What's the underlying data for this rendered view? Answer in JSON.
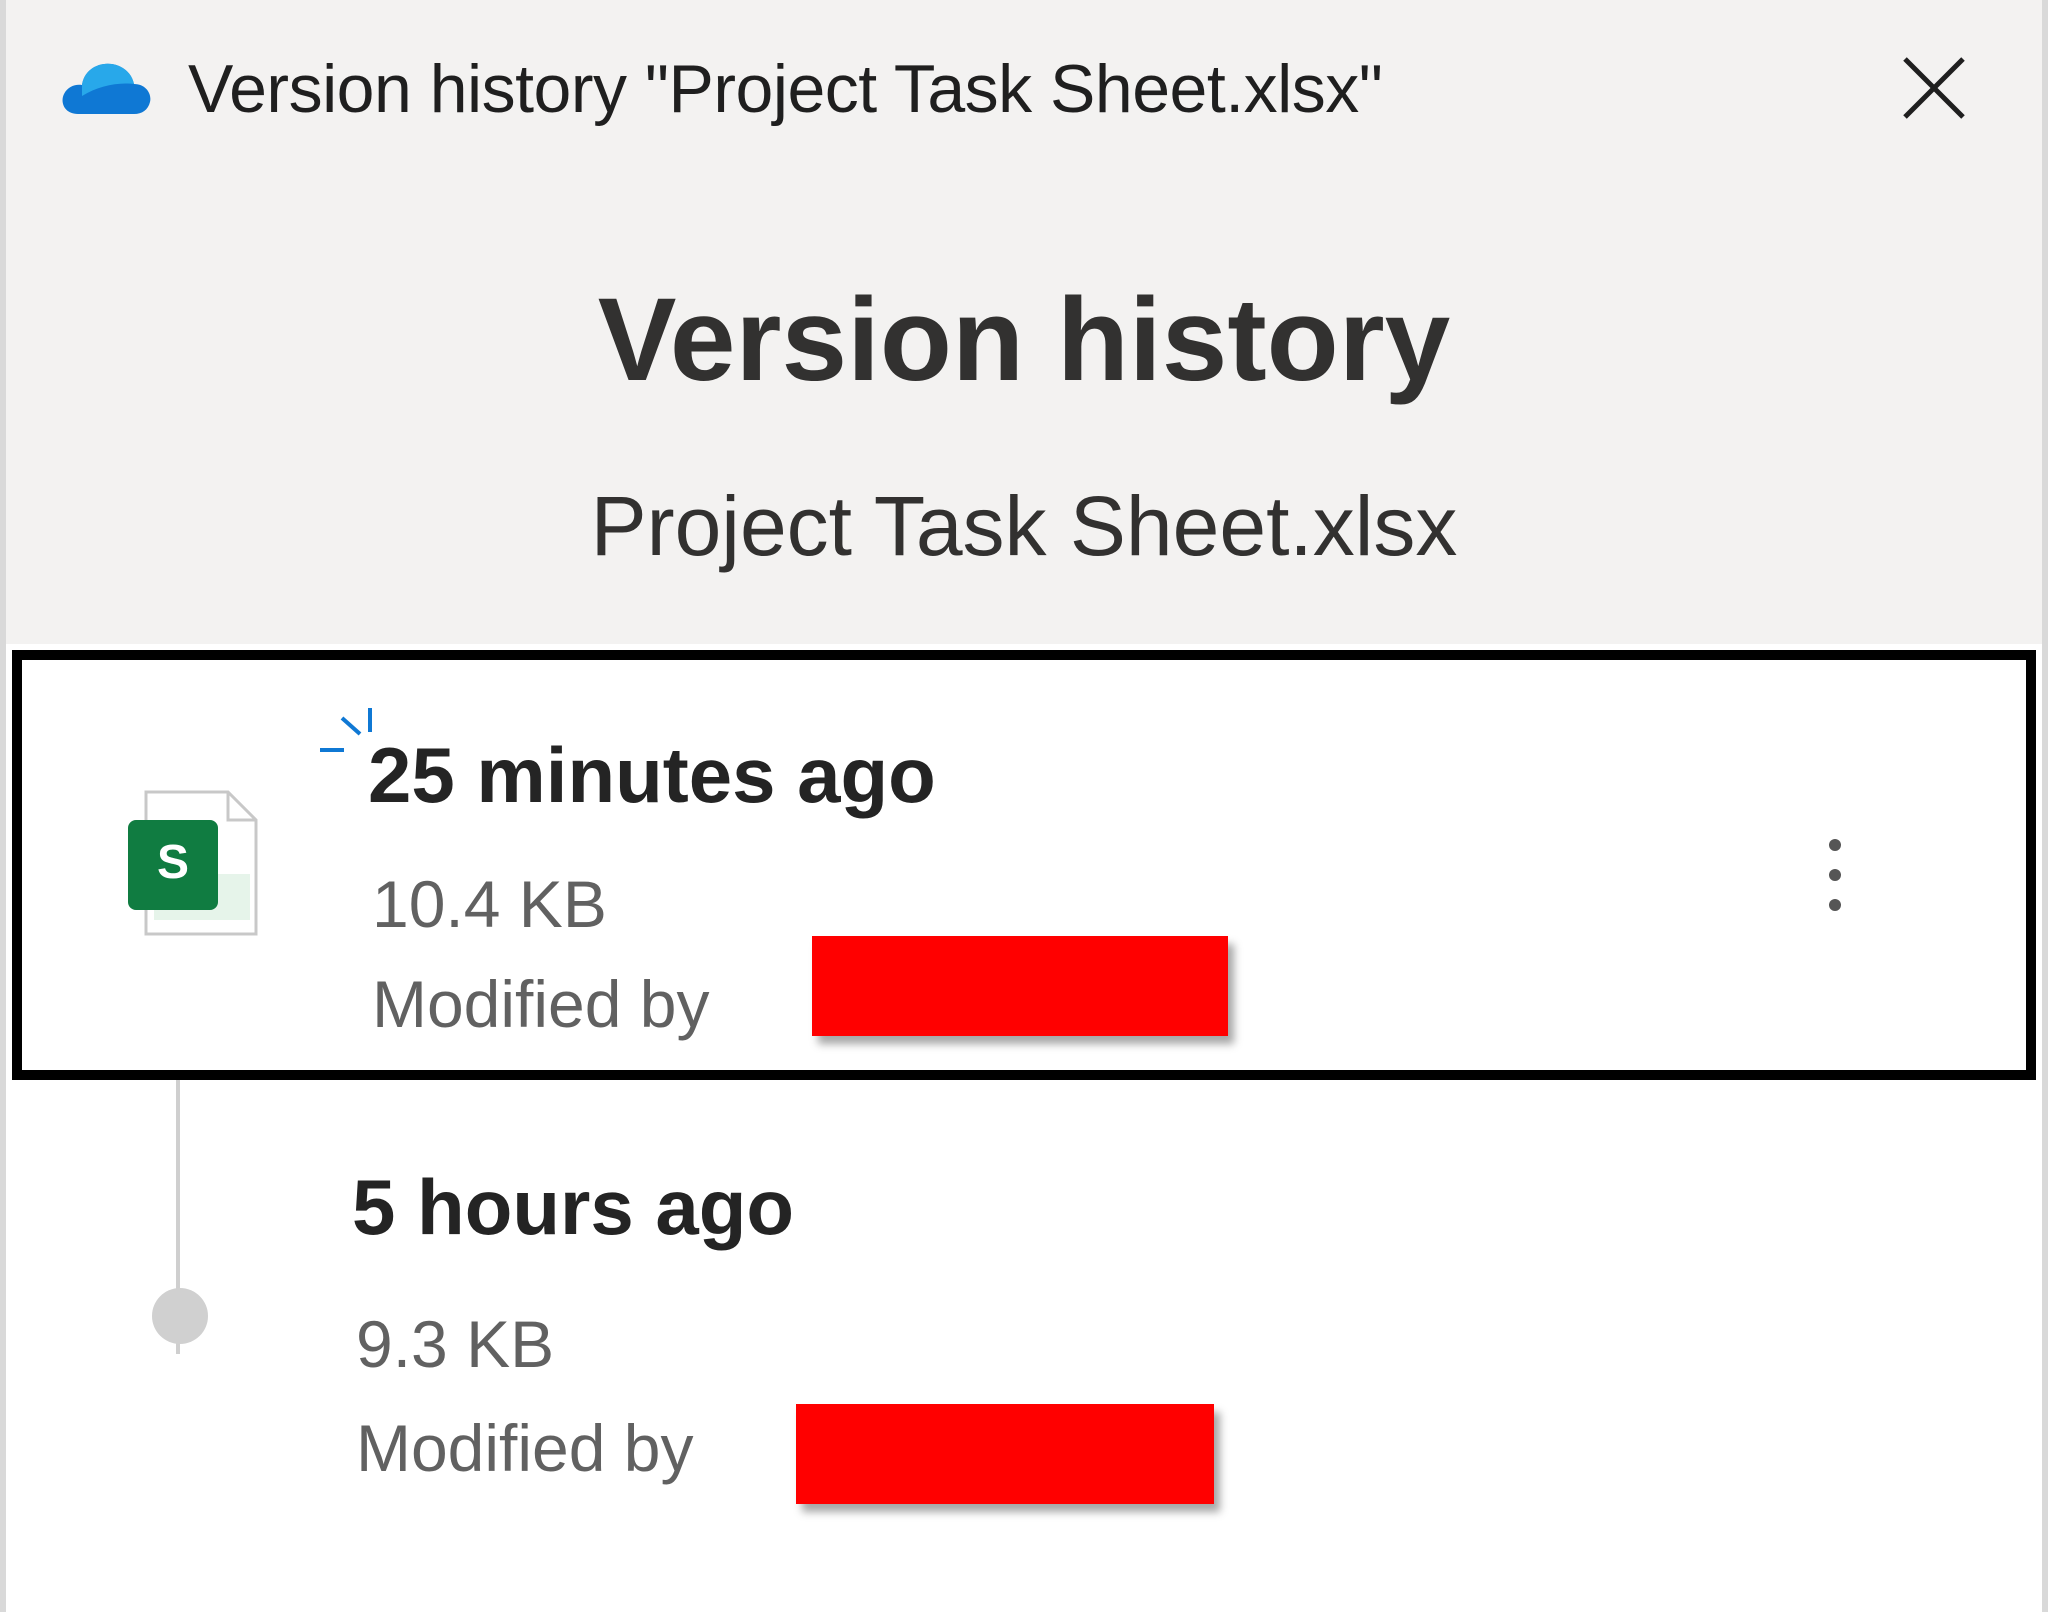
{
  "window": {
    "title": "Version history \"Project Task Sheet.xlsx\"",
    "app_icon": "onedrive-cloud-icon",
    "close_icon": "close-icon"
  },
  "header": {
    "title": "Version history",
    "file_name": "Project Task Sheet.xlsx"
  },
  "versions": [
    {
      "time": "25 minutes ago",
      "size": "10.4 KB",
      "modified_prefix": "Modified by",
      "modified_by": "",
      "selected": true,
      "icon": "spreadsheet-file-icon",
      "file_icon_letter": "S",
      "status_icon": "loading-spinner-icon",
      "more_icon": "more-options-icon"
    },
    {
      "time": "5 hours ago",
      "size": "9.3 KB",
      "modified_prefix": "Modified by",
      "modified_by": "",
      "selected": false,
      "icon": "timeline-dot"
    }
  ],
  "colors": {
    "header_bg": "#f3f2f1",
    "selection_border": "#000000",
    "redaction": "#ff0000",
    "onedrive_blue": "#0f78d4",
    "excel_green": "#107c41"
  }
}
